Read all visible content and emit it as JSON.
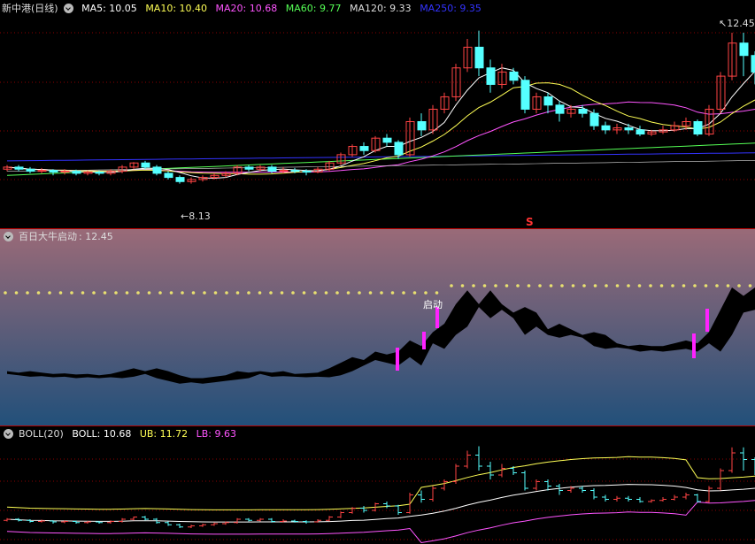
{
  "main_panel": {
    "title": "新中港(日线)",
    "ma": [
      {
        "label": "MA5: 10.05",
        "color": "#ffffff"
      },
      {
        "label": "MA10: 10.40",
        "color": "#ffff55"
      },
      {
        "label": "MA20: 10.68",
        "color": "#ff55ff"
      },
      {
        "label": "MA60: 9.77",
        "color": "#55ff55"
      },
      {
        "label": "MA120: 9.33",
        "color": "#dddddd"
      },
      {
        "label": "MA250: 9.35",
        "color": "#3333ff"
      }
    ],
    "high_label": "12.45",
    "low_label": "8.13",
    "marker": "S"
  },
  "mid_panel": {
    "title": "百日大牛启动",
    "value": ": 12.45",
    "signal_label": "启动"
  },
  "boll_panel": {
    "title": "BOLL(20)",
    "values": [
      {
        "label": "BOLL: 10.68",
        "color": "#ffffff"
      },
      {
        "label": "UB: 11.72",
        "color": "#ffff55"
      },
      {
        "label": "LB: 9.63",
        "color": "#ff55ff"
      }
    ]
  },
  "colors": {
    "up": "#ff4444",
    "down": "#55ffff",
    "separator": "#b00000"
  },
  "chart_data": {
    "type": "candlestick",
    "price_range": [
      8.0,
      12.6
    ],
    "candles": [
      [
        9.15,
        9.2,
        9.25,
        9.1
      ],
      [
        9.2,
        9.15,
        9.25,
        9.1
      ],
      [
        9.15,
        9.1,
        9.2,
        9.05
      ],
      [
        9.1,
        9.12,
        9.18,
        9.05
      ],
      [
        9.12,
        9.08,
        9.15,
        9.0
      ],
      [
        9.08,
        9.1,
        9.15,
        9.02
      ],
      [
        9.1,
        9.05,
        9.14,
        9.0
      ],
      [
        9.05,
        9.08,
        9.12,
        9.0
      ],
      [
        9.08,
        9.05,
        9.12,
        9.0
      ],
      [
        9.05,
        9.1,
        9.15,
        9.0
      ],
      [
        9.1,
        9.2,
        9.25,
        9.05
      ],
      [
        9.2,
        9.3,
        9.32,
        9.15
      ],
      [
        9.3,
        9.2,
        9.35,
        9.15
      ],
      [
        9.2,
        9.05,
        9.25,
        9.0
      ],
      [
        9.05,
        8.95,
        9.1,
        8.9
      ],
      [
        8.95,
        8.85,
        9.0,
        8.8
      ],
      [
        8.85,
        8.9,
        8.95,
        8.8
      ],
      [
        8.9,
        8.95,
        9.0,
        8.85
      ],
      [
        8.95,
        9.0,
        9.05,
        8.9
      ],
      [
        9.0,
        9.05,
        9.1,
        8.95
      ],
      [
        9.05,
        9.2,
        9.25,
        9.0
      ],
      [
        9.2,
        9.15,
        9.25,
        9.1
      ],
      [
        9.15,
        9.2,
        9.25,
        9.1
      ],
      [
        9.2,
        9.1,
        9.25,
        9.05
      ],
      [
        9.1,
        9.12,
        9.2,
        9.05
      ],
      [
        9.12,
        9.1,
        9.18,
        9.05
      ],
      [
        9.1,
        9.08,
        9.15,
        9.0
      ],
      [
        9.08,
        9.15,
        9.2,
        9.05
      ],
      [
        9.15,
        9.3,
        9.35,
        9.1
      ],
      [
        9.3,
        9.5,
        9.55,
        9.25
      ],
      [
        9.5,
        9.7,
        9.75,
        9.45
      ],
      [
        9.7,
        9.6,
        9.8,
        9.5
      ],
      [
        9.6,
        9.9,
        9.95,
        9.55
      ],
      [
        9.9,
        9.8,
        10.0,
        9.7
      ],
      [
        9.8,
        9.5,
        9.85,
        9.4
      ],
      [
        9.5,
        10.3,
        10.4,
        9.45
      ],
      [
        10.3,
        10.1,
        10.5,
        9.95
      ],
      [
        10.1,
        10.6,
        10.7,
        10.0
      ],
      [
        10.6,
        10.9,
        11.0,
        10.5
      ],
      [
        10.9,
        11.6,
        11.7,
        10.8
      ],
      [
        11.6,
        12.1,
        12.3,
        11.5
      ],
      [
        12.1,
        11.6,
        12.5,
        11.4
      ],
      [
        11.6,
        11.2,
        11.8,
        11.0
      ],
      [
        11.2,
        11.5,
        11.7,
        11.1
      ],
      [
        11.5,
        11.3,
        11.6,
        11.2
      ],
      [
        11.3,
        10.6,
        11.4,
        10.5
      ],
      [
        10.6,
        10.9,
        11.0,
        10.5
      ],
      [
        10.9,
        10.7,
        11.0,
        10.5
      ],
      [
        10.7,
        10.5,
        10.8,
        10.3
      ],
      [
        10.5,
        10.6,
        10.7,
        10.4
      ],
      [
        10.6,
        10.5,
        10.7,
        10.4
      ],
      [
        10.5,
        10.2,
        10.6,
        10.1
      ],
      [
        10.2,
        10.1,
        10.3,
        10.0
      ],
      [
        10.1,
        10.15,
        10.25,
        10.0
      ],
      [
        10.15,
        10.1,
        10.25,
        10.0
      ],
      [
        10.1,
        10.0,
        10.2,
        9.95
      ],
      [
        10.0,
        10.05,
        10.1,
        9.95
      ],
      [
        10.05,
        10.1,
        10.2,
        10.0
      ],
      [
        10.1,
        10.2,
        10.3,
        10.05
      ],
      [
        10.2,
        10.3,
        10.4,
        10.1
      ],
      [
        10.3,
        10.0,
        10.35,
        9.95
      ],
      [
        10.0,
        10.6,
        10.7,
        9.95
      ],
      [
        10.6,
        11.4,
        11.5,
        10.5
      ],
      [
        11.4,
        12.2,
        12.45,
        11.3
      ],
      [
        12.2,
        11.9,
        12.45,
        11.4
      ],
      [
        11.9,
        11.5,
        12.0,
        11.2
      ]
    ]
  }
}
